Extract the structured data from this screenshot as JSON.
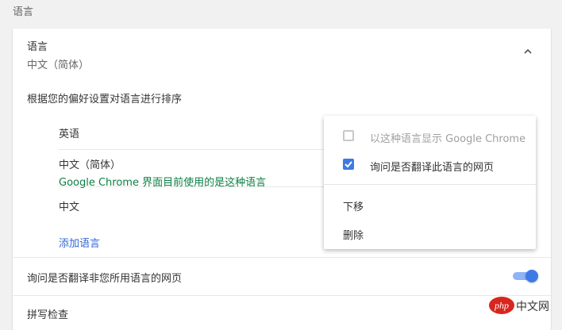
{
  "section": {
    "title": "语言"
  },
  "languages_card": {
    "title": "语言",
    "subtitle": "中文（简体）",
    "order_description": "根据您的偏好设置对语言进行排序",
    "list": [
      {
        "name": "英语",
        "note": ""
      },
      {
        "name": "中文（简体）",
        "note": "Google Chrome 界面目前使用的是这种语言"
      },
      {
        "name": "中文",
        "note": ""
      }
    ],
    "add_language": "添加语言",
    "ask_translate_label": "询问是否翻译非您所用语言的网页",
    "ask_translate_enabled": true,
    "spellcheck_label": "拼写检查"
  },
  "context_menu": {
    "display_in_language": {
      "label": "以这种语言显示 Google Chrome",
      "checked": false,
      "disabled": true
    },
    "offer_translate": {
      "label": "询问是否翻译此语言的网页",
      "checked": true
    },
    "move_down": "下移",
    "remove": "删除"
  },
  "watermark": {
    "badge": "php",
    "site": "中文网"
  },
  "colors": {
    "accent": "#3d7ae5",
    "link": "#3367d6",
    "note_green": "#0b8043"
  }
}
